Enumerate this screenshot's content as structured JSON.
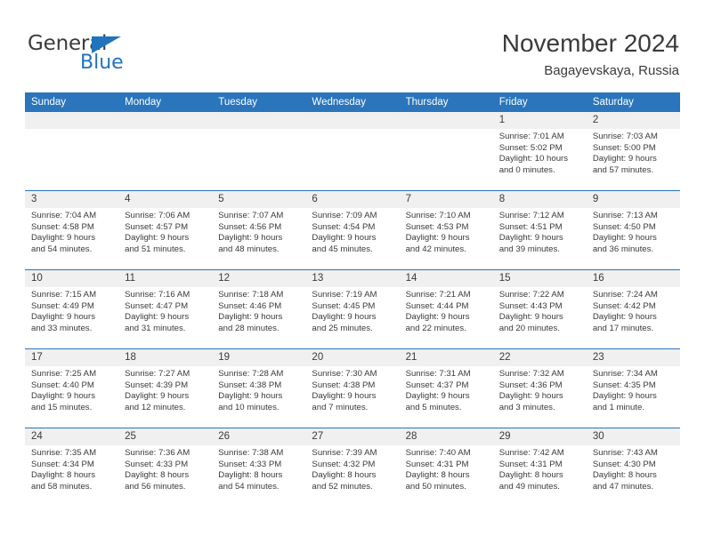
{
  "brand": {
    "word_one": "General",
    "word_two": "Blue",
    "accent_color": "#1f74bd"
  },
  "header": {
    "title": "November 2024",
    "subtitle": "Bagayevskaya, Russia"
  },
  "theme": {
    "header_blue": "#2a75bb",
    "day_band_gray": "#f0f0f0",
    "text_color": "#3a3a3a"
  },
  "weekdays": [
    "Sunday",
    "Monday",
    "Tuesday",
    "Wednesday",
    "Thursday",
    "Friday",
    "Saturday"
  ],
  "weeks": [
    [
      {
        "day": "",
        "lines": []
      },
      {
        "day": "",
        "lines": []
      },
      {
        "day": "",
        "lines": []
      },
      {
        "day": "",
        "lines": []
      },
      {
        "day": "",
        "lines": []
      },
      {
        "day": "1",
        "lines": [
          "Sunrise: 7:01 AM",
          "Sunset: 5:02 PM",
          "Daylight: 10 hours",
          "and 0 minutes."
        ]
      },
      {
        "day": "2",
        "lines": [
          "Sunrise: 7:03 AM",
          "Sunset: 5:00 PM",
          "Daylight: 9 hours",
          "and 57 minutes."
        ]
      }
    ],
    [
      {
        "day": "3",
        "lines": [
          "Sunrise: 7:04 AM",
          "Sunset: 4:58 PM",
          "Daylight: 9 hours",
          "and 54 minutes."
        ]
      },
      {
        "day": "4",
        "lines": [
          "Sunrise: 7:06 AM",
          "Sunset: 4:57 PM",
          "Daylight: 9 hours",
          "and 51 minutes."
        ]
      },
      {
        "day": "5",
        "lines": [
          "Sunrise: 7:07 AM",
          "Sunset: 4:56 PM",
          "Daylight: 9 hours",
          "and 48 minutes."
        ]
      },
      {
        "day": "6",
        "lines": [
          "Sunrise: 7:09 AM",
          "Sunset: 4:54 PM",
          "Daylight: 9 hours",
          "and 45 minutes."
        ]
      },
      {
        "day": "7",
        "lines": [
          "Sunrise: 7:10 AM",
          "Sunset: 4:53 PM",
          "Daylight: 9 hours",
          "and 42 minutes."
        ]
      },
      {
        "day": "8",
        "lines": [
          "Sunrise: 7:12 AM",
          "Sunset: 4:51 PM",
          "Daylight: 9 hours",
          "and 39 minutes."
        ]
      },
      {
        "day": "9",
        "lines": [
          "Sunrise: 7:13 AM",
          "Sunset: 4:50 PM",
          "Daylight: 9 hours",
          "and 36 minutes."
        ]
      }
    ],
    [
      {
        "day": "10",
        "lines": [
          "Sunrise: 7:15 AM",
          "Sunset: 4:49 PM",
          "Daylight: 9 hours",
          "and 33 minutes."
        ]
      },
      {
        "day": "11",
        "lines": [
          "Sunrise: 7:16 AM",
          "Sunset: 4:47 PM",
          "Daylight: 9 hours",
          "and 31 minutes."
        ]
      },
      {
        "day": "12",
        "lines": [
          "Sunrise: 7:18 AM",
          "Sunset: 4:46 PM",
          "Daylight: 9 hours",
          "and 28 minutes."
        ]
      },
      {
        "day": "13",
        "lines": [
          "Sunrise: 7:19 AM",
          "Sunset: 4:45 PM",
          "Daylight: 9 hours",
          "and 25 minutes."
        ]
      },
      {
        "day": "14",
        "lines": [
          "Sunrise: 7:21 AM",
          "Sunset: 4:44 PM",
          "Daylight: 9 hours",
          "and 22 minutes."
        ]
      },
      {
        "day": "15",
        "lines": [
          "Sunrise: 7:22 AM",
          "Sunset: 4:43 PM",
          "Daylight: 9 hours",
          "and 20 minutes."
        ]
      },
      {
        "day": "16",
        "lines": [
          "Sunrise: 7:24 AM",
          "Sunset: 4:42 PM",
          "Daylight: 9 hours",
          "and 17 minutes."
        ]
      }
    ],
    [
      {
        "day": "17",
        "lines": [
          "Sunrise: 7:25 AM",
          "Sunset: 4:40 PM",
          "Daylight: 9 hours",
          "and 15 minutes."
        ]
      },
      {
        "day": "18",
        "lines": [
          "Sunrise: 7:27 AM",
          "Sunset: 4:39 PM",
          "Daylight: 9 hours",
          "and 12 minutes."
        ]
      },
      {
        "day": "19",
        "lines": [
          "Sunrise: 7:28 AM",
          "Sunset: 4:38 PM",
          "Daylight: 9 hours",
          "and 10 minutes."
        ]
      },
      {
        "day": "20",
        "lines": [
          "Sunrise: 7:30 AM",
          "Sunset: 4:38 PM",
          "Daylight: 9 hours",
          "and 7 minutes."
        ]
      },
      {
        "day": "21",
        "lines": [
          "Sunrise: 7:31 AM",
          "Sunset: 4:37 PM",
          "Daylight: 9 hours",
          "and 5 minutes."
        ]
      },
      {
        "day": "22",
        "lines": [
          "Sunrise: 7:32 AM",
          "Sunset: 4:36 PM",
          "Daylight: 9 hours",
          "and 3 minutes."
        ]
      },
      {
        "day": "23",
        "lines": [
          "Sunrise: 7:34 AM",
          "Sunset: 4:35 PM",
          "Daylight: 9 hours",
          "and 1 minute."
        ]
      }
    ],
    [
      {
        "day": "24",
        "lines": [
          "Sunrise: 7:35 AM",
          "Sunset: 4:34 PM",
          "Daylight: 8 hours",
          "and 58 minutes."
        ]
      },
      {
        "day": "25",
        "lines": [
          "Sunrise: 7:36 AM",
          "Sunset: 4:33 PM",
          "Daylight: 8 hours",
          "and 56 minutes."
        ]
      },
      {
        "day": "26",
        "lines": [
          "Sunrise: 7:38 AM",
          "Sunset: 4:33 PM",
          "Daylight: 8 hours",
          "and 54 minutes."
        ]
      },
      {
        "day": "27",
        "lines": [
          "Sunrise: 7:39 AM",
          "Sunset: 4:32 PM",
          "Daylight: 8 hours",
          "and 52 minutes."
        ]
      },
      {
        "day": "28",
        "lines": [
          "Sunrise: 7:40 AM",
          "Sunset: 4:31 PM",
          "Daylight: 8 hours",
          "and 50 minutes."
        ]
      },
      {
        "day": "29",
        "lines": [
          "Sunrise: 7:42 AM",
          "Sunset: 4:31 PM",
          "Daylight: 8 hours",
          "and 49 minutes."
        ]
      },
      {
        "day": "30",
        "lines": [
          "Sunrise: 7:43 AM",
          "Sunset: 4:30 PM",
          "Daylight: 8 hours",
          "and 47 minutes."
        ]
      }
    ]
  ]
}
